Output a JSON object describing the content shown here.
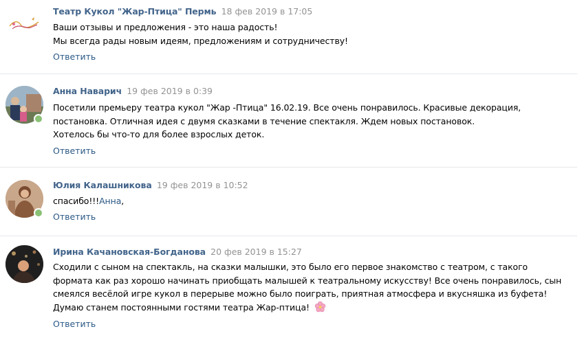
{
  "reply_label": "Ответить",
  "colors": {
    "author": "#42648b",
    "link": "#2a5885",
    "date": "#939393",
    "online": "#8ac176",
    "divider": "#e7e8ec"
  },
  "comments": [
    {
      "author": "Театр Кукол \"Жар-Птица\" Пермь",
      "date": "18 фев 2019 в 17:05",
      "avatar_logo_text": "Театр Кукол Жар-Птица",
      "lines": [
        "Ваши отзывы и предложения - это наша радость!",
        "Мы всегда рады новым идеям, предложениям и сотрудничеству!"
      ]
    },
    {
      "author": "Анна Наварич",
      "date": "19 фев 2019 в 0:39",
      "lines": [
        "Посетили премьеру театра кукол \"Жар -Птица\" 16.02.19. Все очень понравилось. Красивые декорация,",
        "постановка. Отличная идея с двумя сказками в течение спектакля. Ждем новых постановок.",
        "Хотелось бы что-то для более взрослых деток."
      ]
    },
    {
      "author": "Юлия Калашникова",
      "date": "19 фев 2019 в 10:52",
      "text_prefix": "спасибо!!!",
      "mention": "Анна",
      "text_suffix": ","
    },
    {
      "author": "Ирина Качановская-Богданова",
      "date": "20 фев 2019 в 15:27",
      "lines": [
        "Сходили с сыном на спектакль, на сказки малышки, это было его первое знакомство с театром, с такого",
        "формата как раз хорошо начинать приобщать малышей к театральному искусству! Все очень понравилось, сын",
        "смеялся весёлой игре кукол в перерыве можно было поиграть, приятная атмосфера и вкусняшка из буфета!",
        "Думаю станем постоянными гостями театра Жар-птица!"
      ],
      "emoji": "cherry-blossom"
    }
  ]
}
